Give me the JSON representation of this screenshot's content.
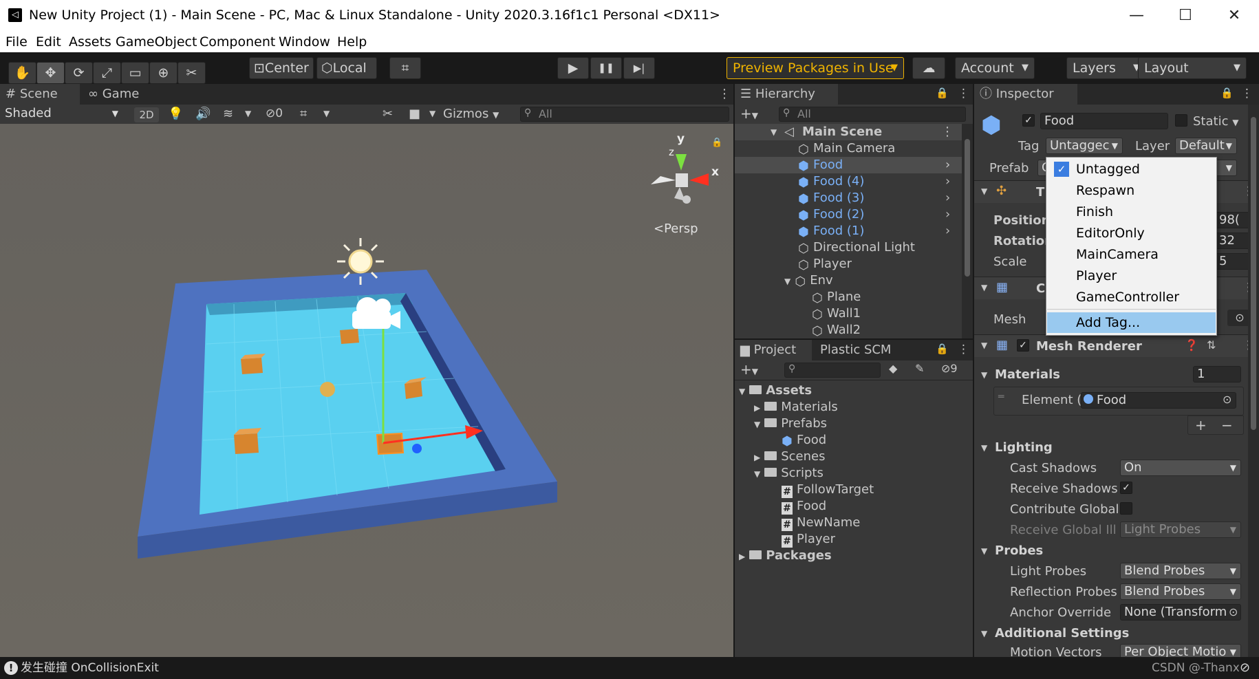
{
  "window": {
    "title": "New Unity Project (1) - Main Scene - PC, Mac & Linux Standalone - Unity 2020.3.16f1c1 Personal <DX11>",
    "app_icon": "unity-icon",
    "minimize": "—",
    "maximize": "☐",
    "close": "✕"
  },
  "menubar": [
    "File",
    "Edit",
    "Assets",
    "GameObject",
    "Component",
    "Window",
    "Help"
  ],
  "toolbar": {
    "tools": [
      "hand-icon",
      "move-icon",
      "rotate-icon",
      "scale-icon",
      "rect-icon",
      "transform-icon",
      "custom-tool-icon"
    ],
    "pivot": "Center",
    "space": "Local",
    "play": "▶",
    "pause": "❚❚",
    "step": "▶|",
    "preview_packages": "Preview Packages in Use",
    "account": "Account",
    "layers": "Layers",
    "layout": "Layout",
    "accent": "#f0b400"
  },
  "scene": {
    "tab_scene": "Scene",
    "tab_game": "Game",
    "shading": "Shaded",
    "mode_2d": "2D",
    "hidden_count": "0",
    "gizmos": "Gizmos",
    "search_placeholder": "All",
    "persp": "Persp",
    "axis_x": "x",
    "axis_y": "y",
    "axis_z": "z",
    "colors": {
      "floor": "#5ad0f0",
      "wall": "#4e72c0",
      "food": "#d7852e",
      "bg": "#6b6760"
    }
  },
  "hierarchy": {
    "tab": "Hierarchy",
    "search_placeholder": "All",
    "scene_name": "Main Scene",
    "items": [
      {
        "label": "Main Camera",
        "prefab": false
      },
      {
        "label": "Food",
        "prefab": true,
        "selected": true
      },
      {
        "label": "Food (4)",
        "prefab": true
      },
      {
        "label": "Food (3)",
        "prefab": true
      },
      {
        "label": "Food (2)",
        "prefab": true
      },
      {
        "label": "Food (1)",
        "prefab": true
      },
      {
        "label": "Directional Light",
        "prefab": false
      },
      {
        "label": "Player",
        "prefab": false
      },
      {
        "label": "Env",
        "prefab": false
      },
      {
        "label": "Plane",
        "prefab": false
      },
      {
        "label": "Wall1",
        "prefab": false
      },
      {
        "label": "Wall2",
        "prefab": false
      }
    ]
  },
  "project": {
    "tab_project": "Project",
    "tab_plastic": "Plastic SCM",
    "hidden_count": "9",
    "tree": [
      {
        "label": "Assets",
        "bold": true
      },
      {
        "label": "Materials"
      },
      {
        "label": "Prefabs"
      },
      {
        "label": "Food"
      },
      {
        "label": "Scenes"
      },
      {
        "label": "Scripts"
      },
      {
        "label": "FollowTarget"
      },
      {
        "label": "Food"
      },
      {
        "label": "NewName"
      },
      {
        "label": "Player"
      },
      {
        "label": "Packages",
        "bold": true
      }
    ]
  },
  "inspector": {
    "tab": "Inspector",
    "object_name": "Food",
    "static_label": "Static",
    "tag_label": "Tag",
    "tag_value": "Untaggec",
    "layer_label": "Layer",
    "layer_value": "Default",
    "prefab_label": "Prefab",
    "prefab_value": "C",
    "transform_header": "T",
    "position_label": "Position",
    "position_value_tail": "98(",
    "rotation_label": "Rotation",
    "rotation_value_tail": "32",
    "scale_label": "Scale",
    "scale_value_tail": "5",
    "meshfilter_header": "C",
    "mesh_label": "Mesh",
    "mesh_renderer": "Mesh Renderer",
    "materials_label": "Materials",
    "materials_count": "1",
    "element_label": "Element (",
    "element_value": "Food",
    "add": "+",
    "remove": "−",
    "lighting": "Lighting",
    "cast_shadows_label": "Cast Shadows",
    "cast_shadows_value": "On",
    "receive_shadows_label": "Receive Shadows",
    "contribute_gi_label": "Contribute Global",
    "receive_gi_label": "Receive Global Ill",
    "receive_gi_value": "Light Probes",
    "probes": "Probes",
    "light_probes_label": "Light Probes",
    "light_probes_value": "Blend Probes",
    "reflection_probes_label": "Reflection Probes",
    "reflection_probes_value": "Blend Probes",
    "anchor_override_label": "Anchor Override",
    "anchor_override_value": "None (Transform",
    "additional_settings": "Additional Settings",
    "motion_vectors_label": "Motion Vectors",
    "motion_vectors_value": "Per Object Motio"
  },
  "tag_menu": {
    "items": [
      "Untagged",
      "Respawn",
      "Finish",
      "EditorOnly",
      "MainCamera",
      "Player",
      "GameController"
    ],
    "checked": "Untagged",
    "add_tag": "Add Tag..."
  },
  "status": {
    "message": "发生碰撞 OnCollisionExit",
    "watermark": "CSDN @-Thanx"
  }
}
